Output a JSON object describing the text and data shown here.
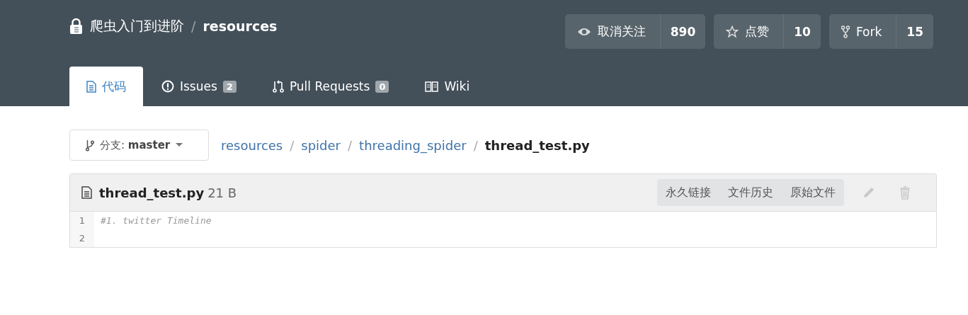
{
  "repo": {
    "owner": "爬虫入门到进阶",
    "separator": "/",
    "name": "resources"
  },
  "actions": [
    {
      "kind": "watch",
      "label": "取消关注",
      "count": "890"
    },
    {
      "kind": "star",
      "label": "点赞",
      "count": "10"
    },
    {
      "kind": "fork",
      "label": "Fork",
      "count": "15"
    }
  ],
  "tabs": [
    {
      "kind": "code",
      "label": "代码",
      "selected": true
    },
    {
      "kind": "issues",
      "label": "Issues",
      "badge": "2",
      "selected": false
    },
    {
      "kind": "pulls",
      "label": "Pull Requests",
      "badge": "0",
      "selected": false
    },
    {
      "kind": "wiki",
      "label": "Wiki",
      "selected": false
    }
  ],
  "branch": {
    "label": "分支:",
    "value": "master"
  },
  "breadcrumb": [
    {
      "kind": "link",
      "text": "resources"
    },
    {
      "kind": "separator",
      "text": "/"
    },
    {
      "kind": "link",
      "text": "spider"
    },
    {
      "kind": "separator",
      "text": "/"
    },
    {
      "kind": "link",
      "text": "threading_spider"
    },
    {
      "kind": "separator",
      "text": "/"
    },
    {
      "kind": "current",
      "text": "thread_test.py"
    }
  ],
  "file": {
    "name": "thread_test.py",
    "size": "21 B",
    "buttons": [
      "永久链接",
      "文件历史",
      "原始文件"
    ],
    "edit_disabled": true,
    "delete_disabled": true,
    "lines": [
      {
        "number": "1",
        "code": "#1. twitter Timeline"
      },
      {
        "number": "2"
      }
    ]
  }
}
